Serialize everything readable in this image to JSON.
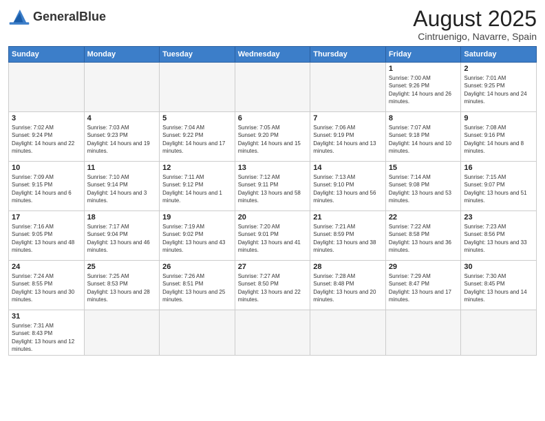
{
  "logo": {
    "text_normal": "General",
    "text_bold": "Blue"
  },
  "calendar": {
    "title": "August 2025",
    "subtitle": "Cintruenigo, Navarre, Spain"
  },
  "headers": [
    "Sunday",
    "Monday",
    "Tuesday",
    "Wednesday",
    "Thursday",
    "Friday",
    "Saturday"
  ],
  "weeks": [
    [
      {
        "day": "",
        "info": ""
      },
      {
        "day": "",
        "info": ""
      },
      {
        "day": "",
        "info": ""
      },
      {
        "day": "",
        "info": ""
      },
      {
        "day": "",
        "info": ""
      },
      {
        "day": "1",
        "info": "Sunrise: 7:00 AM\nSunset: 9:26 PM\nDaylight: 14 hours and 26 minutes."
      },
      {
        "day": "2",
        "info": "Sunrise: 7:01 AM\nSunset: 9:25 PM\nDaylight: 14 hours and 24 minutes."
      }
    ],
    [
      {
        "day": "3",
        "info": "Sunrise: 7:02 AM\nSunset: 9:24 PM\nDaylight: 14 hours and 22 minutes."
      },
      {
        "day": "4",
        "info": "Sunrise: 7:03 AM\nSunset: 9:23 PM\nDaylight: 14 hours and 19 minutes."
      },
      {
        "day": "5",
        "info": "Sunrise: 7:04 AM\nSunset: 9:22 PM\nDaylight: 14 hours and 17 minutes."
      },
      {
        "day": "6",
        "info": "Sunrise: 7:05 AM\nSunset: 9:20 PM\nDaylight: 14 hours and 15 minutes."
      },
      {
        "day": "7",
        "info": "Sunrise: 7:06 AM\nSunset: 9:19 PM\nDaylight: 14 hours and 13 minutes."
      },
      {
        "day": "8",
        "info": "Sunrise: 7:07 AM\nSunset: 9:18 PM\nDaylight: 14 hours and 10 minutes."
      },
      {
        "day": "9",
        "info": "Sunrise: 7:08 AM\nSunset: 9:16 PM\nDaylight: 14 hours and 8 minutes."
      }
    ],
    [
      {
        "day": "10",
        "info": "Sunrise: 7:09 AM\nSunset: 9:15 PM\nDaylight: 14 hours and 6 minutes."
      },
      {
        "day": "11",
        "info": "Sunrise: 7:10 AM\nSunset: 9:14 PM\nDaylight: 14 hours and 3 minutes."
      },
      {
        "day": "12",
        "info": "Sunrise: 7:11 AM\nSunset: 9:12 PM\nDaylight: 14 hours and 1 minute."
      },
      {
        "day": "13",
        "info": "Sunrise: 7:12 AM\nSunset: 9:11 PM\nDaylight: 13 hours and 58 minutes."
      },
      {
        "day": "14",
        "info": "Sunrise: 7:13 AM\nSunset: 9:10 PM\nDaylight: 13 hours and 56 minutes."
      },
      {
        "day": "15",
        "info": "Sunrise: 7:14 AM\nSunset: 9:08 PM\nDaylight: 13 hours and 53 minutes."
      },
      {
        "day": "16",
        "info": "Sunrise: 7:15 AM\nSunset: 9:07 PM\nDaylight: 13 hours and 51 minutes."
      }
    ],
    [
      {
        "day": "17",
        "info": "Sunrise: 7:16 AM\nSunset: 9:05 PM\nDaylight: 13 hours and 48 minutes."
      },
      {
        "day": "18",
        "info": "Sunrise: 7:17 AM\nSunset: 9:04 PM\nDaylight: 13 hours and 46 minutes."
      },
      {
        "day": "19",
        "info": "Sunrise: 7:19 AM\nSunset: 9:02 PM\nDaylight: 13 hours and 43 minutes."
      },
      {
        "day": "20",
        "info": "Sunrise: 7:20 AM\nSunset: 9:01 PM\nDaylight: 13 hours and 41 minutes."
      },
      {
        "day": "21",
        "info": "Sunrise: 7:21 AM\nSunset: 8:59 PM\nDaylight: 13 hours and 38 minutes."
      },
      {
        "day": "22",
        "info": "Sunrise: 7:22 AM\nSunset: 8:58 PM\nDaylight: 13 hours and 36 minutes."
      },
      {
        "day": "23",
        "info": "Sunrise: 7:23 AM\nSunset: 8:56 PM\nDaylight: 13 hours and 33 minutes."
      }
    ],
    [
      {
        "day": "24",
        "info": "Sunrise: 7:24 AM\nSunset: 8:55 PM\nDaylight: 13 hours and 30 minutes."
      },
      {
        "day": "25",
        "info": "Sunrise: 7:25 AM\nSunset: 8:53 PM\nDaylight: 13 hours and 28 minutes."
      },
      {
        "day": "26",
        "info": "Sunrise: 7:26 AM\nSunset: 8:51 PM\nDaylight: 13 hours and 25 minutes."
      },
      {
        "day": "27",
        "info": "Sunrise: 7:27 AM\nSunset: 8:50 PM\nDaylight: 13 hours and 22 minutes."
      },
      {
        "day": "28",
        "info": "Sunrise: 7:28 AM\nSunset: 8:48 PM\nDaylight: 13 hours and 20 minutes."
      },
      {
        "day": "29",
        "info": "Sunrise: 7:29 AM\nSunset: 8:47 PM\nDaylight: 13 hours and 17 minutes."
      },
      {
        "day": "30",
        "info": "Sunrise: 7:30 AM\nSunset: 8:45 PM\nDaylight: 13 hours and 14 minutes."
      }
    ],
    [
      {
        "day": "31",
        "info": "Sunrise: 7:31 AM\nSunset: 8:43 PM\nDaylight: 13 hours and 12 minutes."
      },
      {
        "day": "",
        "info": ""
      },
      {
        "day": "",
        "info": ""
      },
      {
        "day": "",
        "info": ""
      },
      {
        "day": "",
        "info": ""
      },
      {
        "day": "",
        "info": ""
      },
      {
        "day": "",
        "info": ""
      }
    ]
  ]
}
